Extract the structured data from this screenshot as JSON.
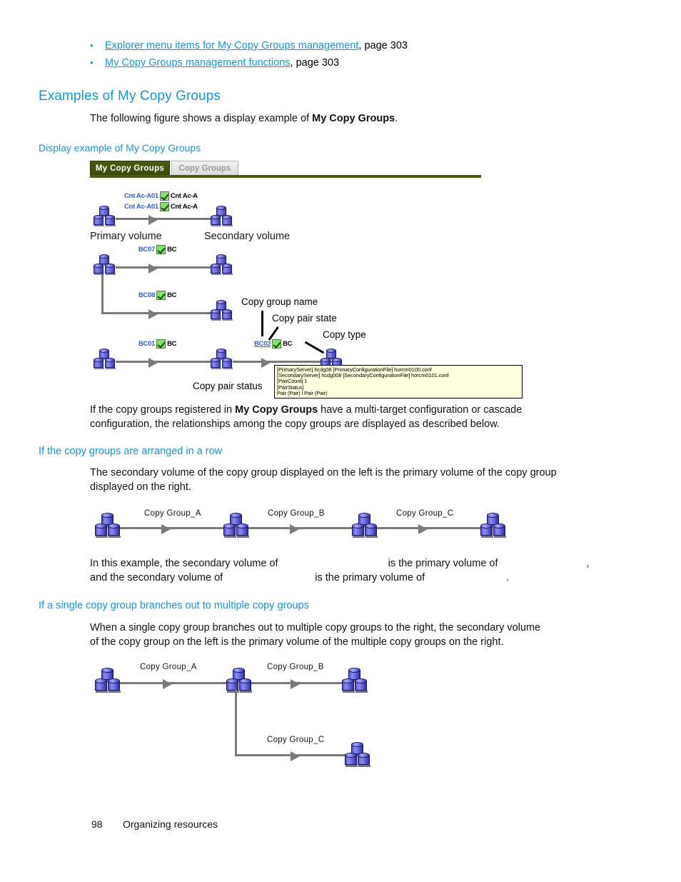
{
  "top_links": [
    {
      "text": "Explorer menu items for My Copy Groups management",
      "tail": " , page 303"
    },
    {
      "text": "My Copy Groups management functions",
      "tail": ", page 303"
    }
  ],
  "section": {
    "heading": "Examples of My Copy Groups",
    "intro_pre": "The following figure shows a display example of ",
    "intro_bold": "My Copy Groups",
    "intro_post": ".",
    "figure_caption": "Display example of My Copy Groups"
  },
  "figure": {
    "tabs": [
      {
        "label": "My Copy Groups",
        "active": true
      },
      {
        "label": "Copy Groups",
        "active": false
      }
    ],
    "volume_labels": {
      "primary": "Primary volume",
      "secondary": "Secondary volume"
    },
    "copy_groups": [
      {
        "name": "Cnt Ac-A01",
        "copy_type": "Cnt Ac-A",
        "linked": false
      },
      {
        "name": "Cnt Ac-A01",
        "copy_type": "Cnt Ac-A",
        "linked": false
      },
      {
        "name": "BC07",
        "copy_type": "BC",
        "linked": false
      },
      {
        "name": "BC08",
        "copy_type": "BC",
        "linked": false
      },
      {
        "name": "BC01",
        "copy_type": "BC",
        "linked": false
      },
      {
        "name": "BC02",
        "copy_type": "BC",
        "linked": true
      }
    ],
    "annotations": {
      "copy_group_name": "Copy group name",
      "copy_pair_state": "Copy pair state",
      "copy_type": "Copy type",
      "copy_pair_status": "Copy pair status"
    },
    "tooltip_lines": [
      "[PrimaryServer] hcdg08 [PrimaryConfigurationFile] horcm0100.conf",
      "[SecondaryServer] hcdg008  [SecondaryConfigurationFile] horcm0101.conf",
      "[PairCount] 1",
      "[PairStatus]",
      "Pair (Pair) l Pair (Pair)"
    ]
  },
  "body": {
    "multi_target_pre": "If the copy groups registered in ",
    "multi_target_bold": "My Copy Groups",
    "multi_target_post": " have a multi-target configuration or cascade",
    "multi_target_line2": "configuration, the relationships among the copy groups are displayed as described below."
  },
  "row_section": {
    "heading": "If the copy groups are arranged in a row",
    "para_line1": "The secondary volume of the copy group displayed on the left is the primary volume of the copy group",
    "para_line2": "displayed on the right.",
    "example_line1_a": "In this example, the secondary volume of",
    "example_line1_b": "is the primary volume of",
    "example_line1_c": ",",
    "example_line2_a": "and the secondary volume of",
    "example_line2_b": "is the primary volume of",
    "example_line2_c": "."
  },
  "row_diagram": {
    "labels": [
      "Copy Group_A",
      "Copy Group_B",
      "Copy Group_C"
    ]
  },
  "branch_section": {
    "heading": "If a single copy group branches out to multiple copy groups",
    "para_line1": "When a single copy group branches out to multiple copy groups to the right, the secondary volume",
    "para_line2": "of the copy group on the left is the primary volume of the multiple copy groups on the right."
  },
  "branch_diagram": {
    "labels": [
      "Copy Group_A",
      "Copy Group_B",
      "Copy Group_C"
    ]
  },
  "footer": {
    "page_number": "98",
    "chapter": "Organizing resources"
  }
}
